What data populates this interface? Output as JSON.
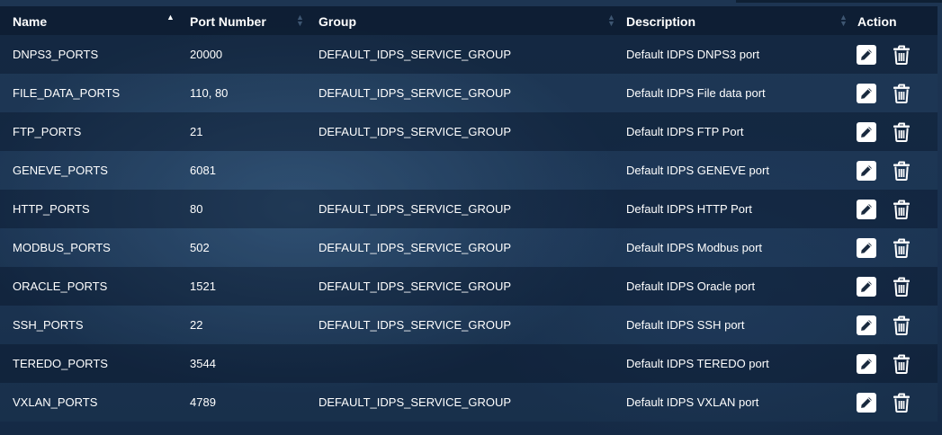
{
  "table": {
    "headers": {
      "name": "Name",
      "port": "Port Number",
      "group": "Group",
      "description": "Description",
      "action": "Action"
    },
    "sort": {
      "column": "name",
      "direction": "asc"
    },
    "rows": [
      {
        "name": "DNPS3_PORTS",
        "port": "20000",
        "group": "DEFAULT_IDPS_SERVICE_GROUP",
        "description": "Default IDPS DNPS3 port"
      },
      {
        "name": "FILE_DATA_PORTS",
        "port": "110, 80",
        "group": "DEFAULT_IDPS_SERVICE_GROUP",
        "description": "Default IDPS File data port"
      },
      {
        "name": "FTP_PORTS",
        "port": "21",
        "group": "DEFAULT_IDPS_SERVICE_GROUP",
        "description": "Default IDPS FTP Port"
      },
      {
        "name": "GENEVE_PORTS",
        "port": "6081",
        "group": "",
        "description": "Default IDPS GENEVE port"
      },
      {
        "name": "HTTP_PORTS",
        "port": "80",
        "group": "DEFAULT_IDPS_SERVICE_GROUP",
        "description": "Default IDPS HTTP Port"
      },
      {
        "name": "MODBUS_PORTS",
        "port": "502",
        "group": "DEFAULT_IDPS_SERVICE_GROUP",
        "description": "Default IDPS Modbus port"
      },
      {
        "name": "ORACLE_PORTS",
        "port": "1521",
        "group": "DEFAULT_IDPS_SERVICE_GROUP",
        "description": "Default IDPS Oracle port"
      },
      {
        "name": "SSH_PORTS",
        "port": "22",
        "group": "DEFAULT_IDPS_SERVICE_GROUP",
        "description": "Default IDPS SSH port"
      },
      {
        "name": "TEREDO_PORTS",
        "port": "3544",
        "group": "",
        "description": "Default IDPS TEREDO port"
      },
      {
        "name": "VXLAN_PORTS",
        "port": "4789",
        "group": "DEFAULT_IDPS_SERVICE_GROUP",
        "description": "Default IDPS VXLAN port"
      }
    ],
    "row_actions": {
      "edit_icon": "pencil-icon",
      "delete_icon": "trash-icon"
    }
  },
  "colors": {
    "header_bg": "#0b1a2e",
    "text": "#ffffff",
    "sort_inactive": "#3e5672"
  }
}
